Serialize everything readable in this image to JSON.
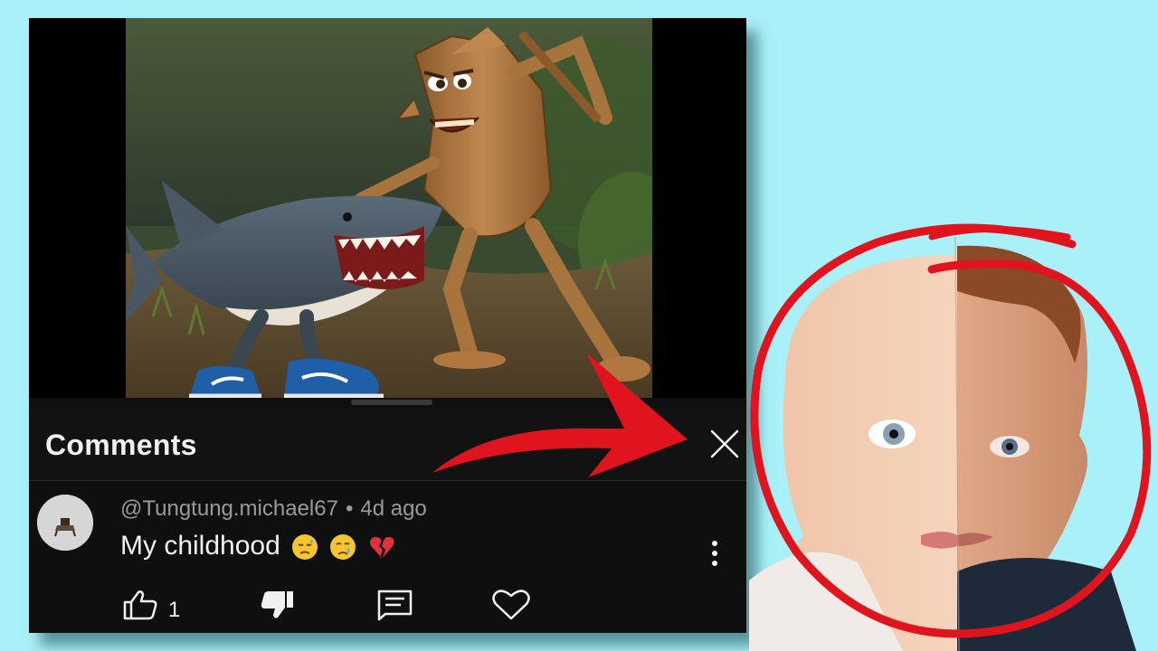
{
  "comments_panel": {
    "title": "Comments",
    "comment": {
      "author": "@Tungtung.michael67",
      "separator": "•",
      "time": "4d ago",
      "text": "My childhood",
      "emojis": [
        "downcast-face-emoji",
        "crying-face-emoji",
        "broken-heart-emoji"
      ],
      "like_count": "1"
    }
  },
  "colors": {
    "background": "#aaf0f8",
    "panel": "#0f0f0f",
    "text_primary": "#f1f1f1",
    "text_secondary": "#9a9a9a",
    "annotation_red": "#e0141e"
  }
}
